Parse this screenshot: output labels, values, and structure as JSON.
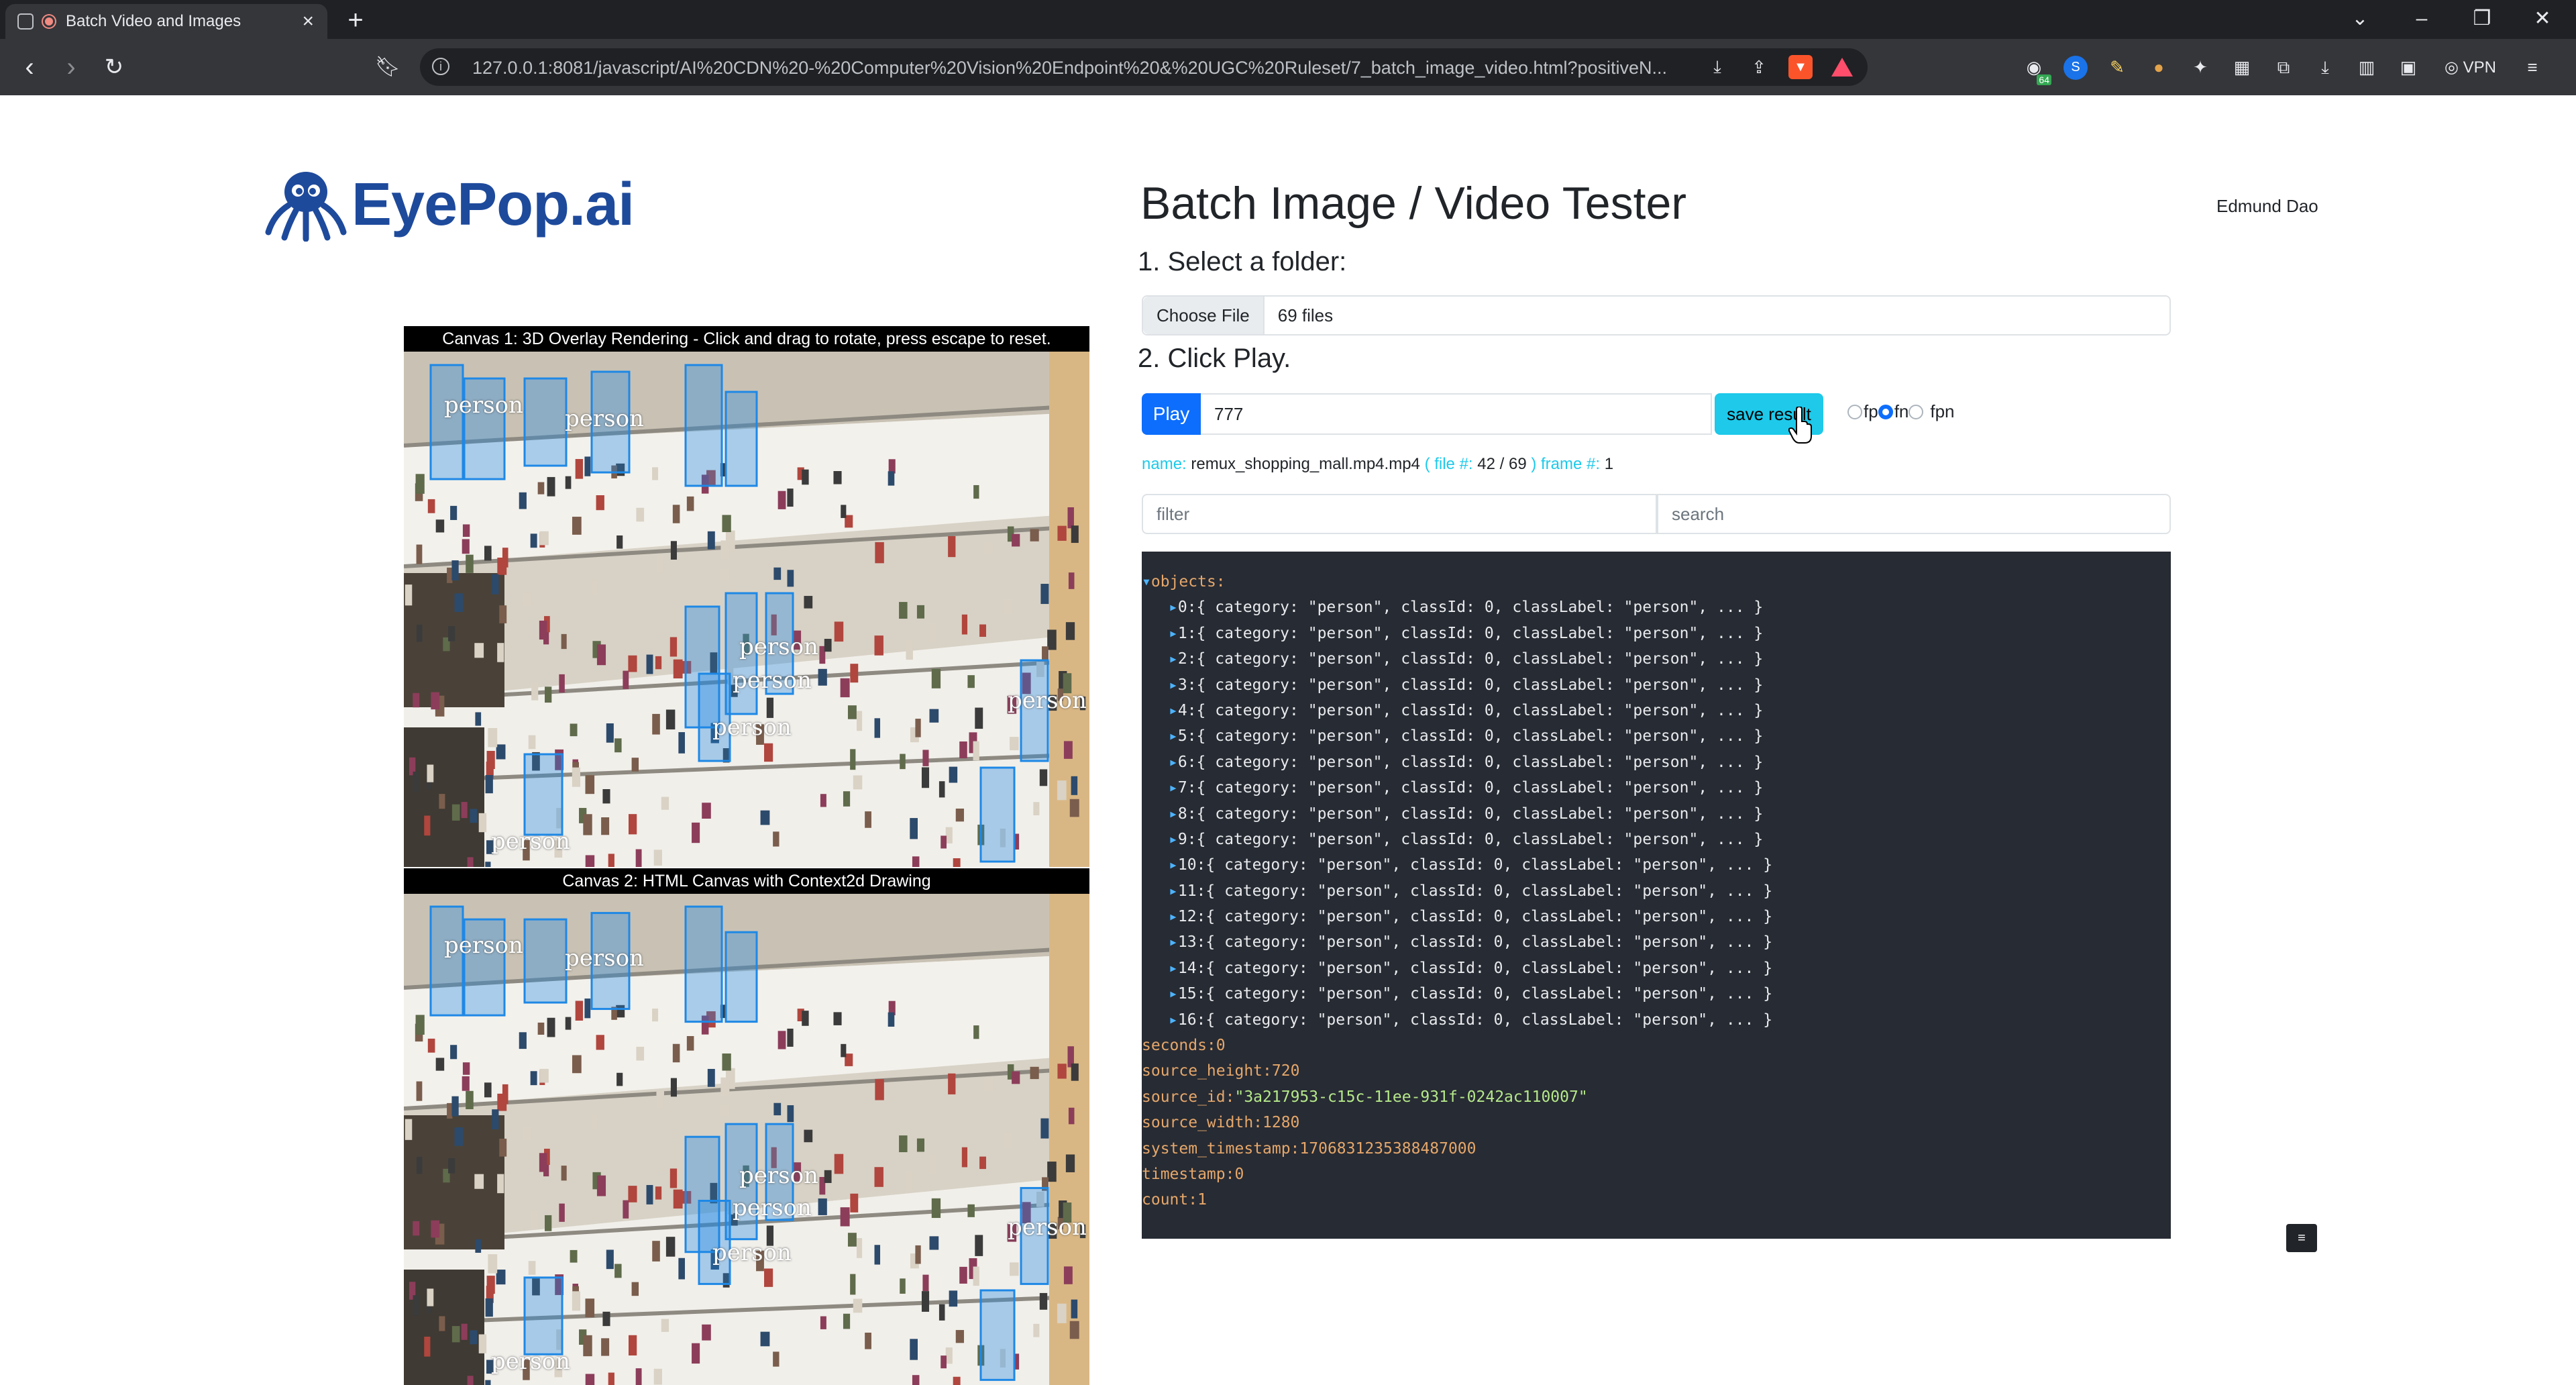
{
  "browser": {
    "tab_title": "Batch Video and Images",
    "url": "127.0.0.1:8081/javascript/AI%20CDN%20-%20Computer%20Vision%20Endpoint%20&%20UGC%20Ruleset/7_batch_image_video.html?positiveN...",
    "vpn_label": "VPN",
    "ext_badge": "64"
  },
  "header": {
    "logo_eye": "Eye",
    "logo_pop": "Pop",
    "logo_ai": ".ai",
    "title": "Batch Image / Video Tester",
    "user": "Edmund Dao"
  },
  "steps": {
    "step1": "1. Select a folder:",
    "step2": "2. Click Play."
  },
  "file_input": {
    "button_label": "Choose File",
    "status": "69 files"
  },
  "controls": {
    "play_label": "Play",
    "play_value": "777",
    "save_label": "save result",
    "radios": [
      {
        "label": "fp",
        "checked": false
      },
      {
        "label": "fn",
        "checked": true
      },
      {
        "label": "fpn",
        "checked": false
      }
    ]
  },
  "meta": {
    "name_label": "name:",
    "name_value": "remux_shopping_mall.mp4.mp4",
    "file_label": "( file #:",
    "file_value": "42 / 69",
    "frame_label": ") frame #:",
    "frame_value": "1"
  },
  "filter": {
    "placeholder": "filter"
  },
  "search": {
    "placeholder": "search"
  },
  "json_view": {
    "objects_key": "objects:",
    "object_rows": [
      "0:{ category: \"person\", classId: 0, classLabel: \"person\", ... }",
      "1:{ category: \"person\", classId: 0, classLabel: \"person\", ... }",
      "2:{ category: \"person\", classId: 0, classLabel: \"person\", ... }",
      "3:{ category: \"person\", classId: 0, classLabel: \"person\", ... }",
      "4:{ category: \"person\", classId: 0, classLabel: \"person\", ... }",
      "5:{ category: \"person\", classId: 0, classLabel: \"person\", ... }",
      "6:{ category: \"person\", classId: 0, classLabel: \"person\", ... }",
      "7:{ category: \"person\", classId: 0, classLabel: \"person\", ... }",
      "8:{ category: \"person\", classId: 0, classLabel: \"person\", ... }",
      "9:{ category: \"person\", classId: 0, classLabel: \"person\", ... }",
      "10:{ category: \"person\", classId: 0, classLabel: \"person\", ... }",
      "11:{ category: \"person\", classId: 0, classLabel: \"person\", ... }",
      "12:{ category: \"person\", classId: 0, classLabel: \"person\", ... }",
      "13:{ category: \"person\", classId: 0, classLabel: \"person\", ... }",
      "14:{ category: \"person\", classId: 0, classLabel: \"person\", ... }",
      "15:{ category: \"person\", classId: 0, classLabel: \"person\", ... }",
      "16:{ category: \"person\", classId: 0, classLabel: \"person\", ... }"
    ],
    "fields": [
      {
        "key": "seconds:",
        "value": "0",
        "type": "num"
      },
      {
        "key": "source_height:",
        "value": "720",
        "type": "num"
      },
      {
        "key": "source_id:",
        "value": "\"3a217953-c15c-11ee-931f-0242ac110007\"",
        "type": "str"
      },
      {
        "key": "source_width:",
        "value": "1280",
        "type": "num"
      },
      {
        "key": "system_timestamp:",
        "value": "1706831235388487000",
        "type": "num"
      },
      {
        "key": "timestamp:",
        "value": "0",
        "type": "num"
      },
      {
        "key": "count:",
        "value": "1",
        "type": "num"
      }
    ]
  },
  "canvas1": {
    "label": "Canvas 1: 3D Overlay Rendering - Click and drag to rotate, press escape to reset."
  },
  "canvas2": {
    "label": "Canvas 2: HTML Canvas with Context2d Drawing"
  },
  "detection_label": "person",
  "colors": {
    "primary": "#0d6efd",
    "save": "#1ec9ea",
    "panel_bg": "#272b33",
    "box": "#1e88e5"
  },
  "icons": {
    "back": "back-arrow-icon",
    "forward": "forward-arrow-icon",
    "reload": "reload-icon",
    "bookmark": "bookmark-icon",
    "info": "info-icon",
    "download": "download-icon",
    "share": "share-icon",
    "menu": "hamburger-menu-icon"
  }
}
